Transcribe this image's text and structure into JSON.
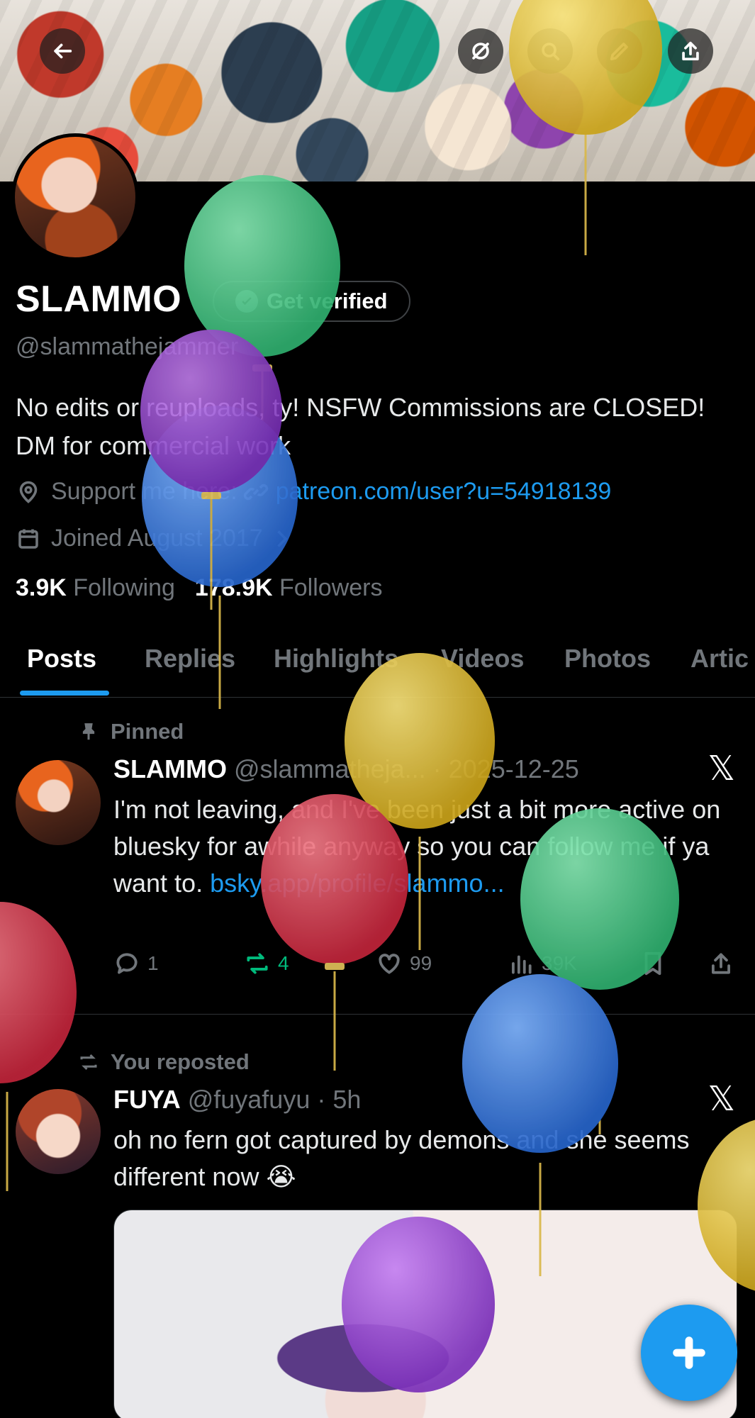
{
  "profile": {
    "name": "SLAMMO",
    "verify_label": "Get verified",
    "handle": "@slammathejammer",
    "bio": "No edits or reuploads, ty! NSFW Commissions are CLOSED! DM for commercial work",
    "location_label": "Support me here:",
    "website": "patreon.com/user?u=54918139",
    "joined": "Joined August 2017",
    "following_count": "3.9K",
    "following_label": "Following",
    "followers_count": "178.9K",
    "followers_label": "Followers"
  },
  "tabs": [
    "Posts",
    "Replies",
    "Highlights",
    "Videos",
    "Photos",
    "Artic"
  ],
  "posts": [
    {
      "label": "Pinned",
      "name": "SLAMMO",
      "meta": "@slammatheja... · 2025-12-25",
      "text_a": "I'm not leaving, and I've been just a bit more active on bluesky for awhile anyway so you can follow me if ya want to. ",
      "text_link": "bsky.app/profile/slammo...",
      "replies": "1",
      "reposts": "4",
      "likes": "99",
      "views": "39K"
    },
    {
      "label": "You reposted",
      "name": "FUYA",
      "meta": "@fuyafuyu · 5h",
      "text_a": "oh no fern got captured by demons and she seems different now 😭"
    }
  ],
  "icons": [
    "back-arrow-icon",
    "grok-icon",
    "search-icon",
    "edit-icon",
    "share-icon",
    "location-icon",
    "link-icon",
    "calendar-icon",
    "chevron-right-icon",
    "pin-icon",
    "x-logo-icon",
    "reply-icon",
    "repost-icon",
    "like-icon",
    "views-icon",
    "bookmark-icon",
    "compose-plus-icon"
  ],
  "colors": {
    "accent": "#1d9bf0",
    "repost": "#00ba7c",
    "muted": "#71767b",
    "background": "#000000"
  }
}
